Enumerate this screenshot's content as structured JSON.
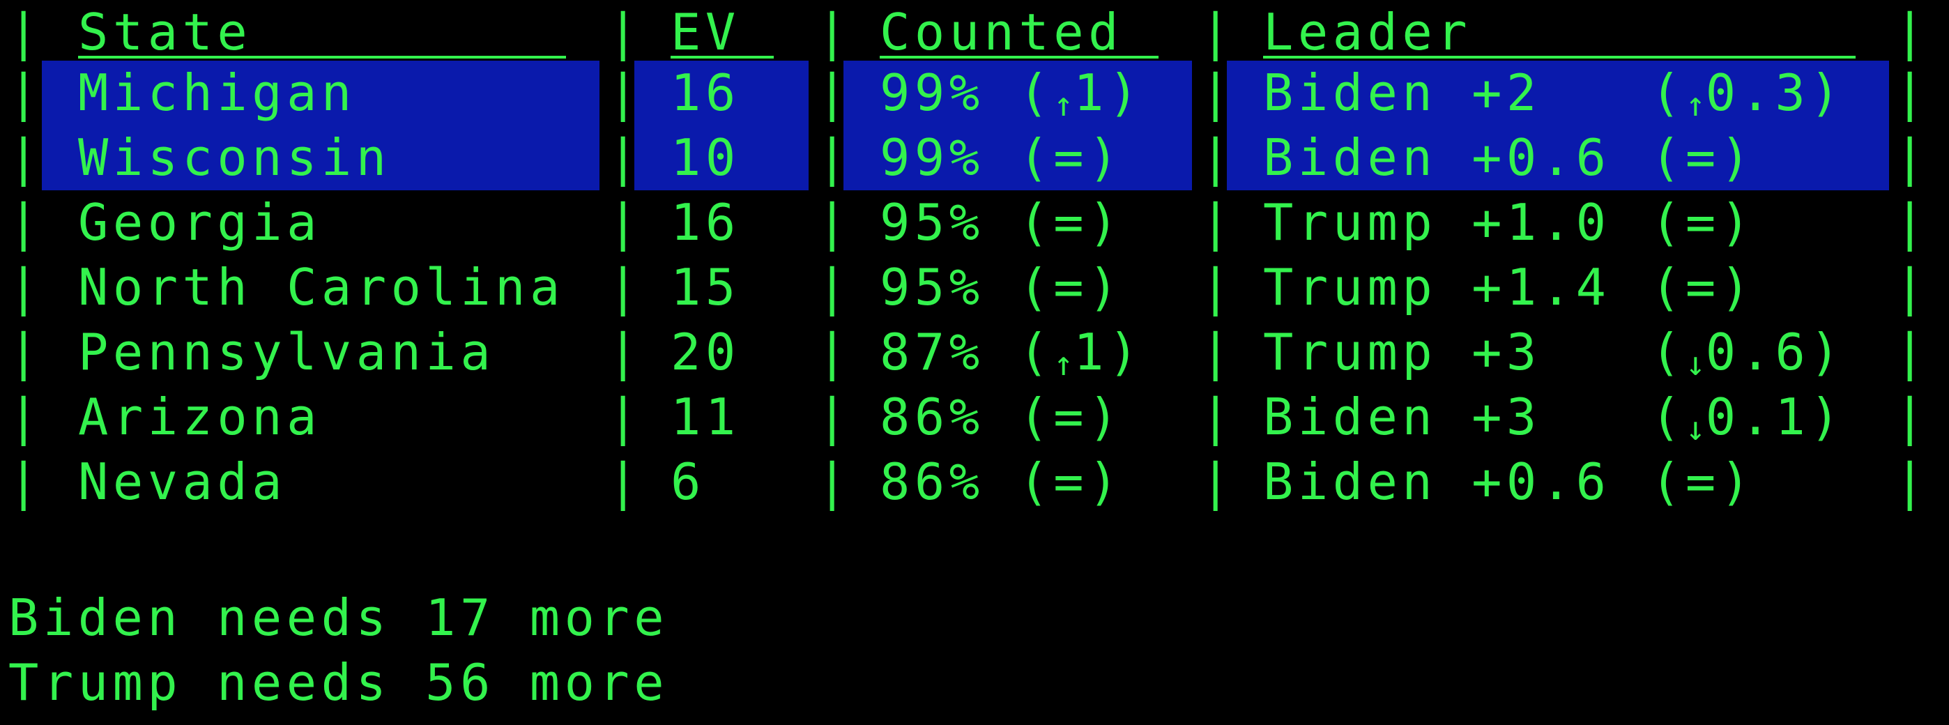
{
  "table": {
    "columns": [
      "State",
      "EV",
      "Counted",
      "Leader"
    ],
    "rows": [
      {
        "state": "Michigan",
        "ev": "16",
        "counted_pct": "99%",
        "counted_delta": "(",
        "counted_arrow": "↑",
        "counted_change": "1)",
        "leader": "Biden +2",
        "leader_delta_open": "(",
        "leader_arrow": "↑",
        "leader_change": "0.3)",
        "highlighted": true
      },
      {
        "state": "Wisconsin",
        "ev": "10",
        "counted_pct": "99%",
        "counted_delta": "(=)",
        "counted_arrow": "",
        "counted_change": "",
        "leader": "Biden +0.6",
        "leader_delta_open": "(=)",
        "leader_arrow": "",
        "leader_change": "",
        "highlighted": true
      },
      {
        "state": "Georgia",
        "ev": "16",
        "counted_pct": "95%",
        "counted_delta": "(=)",
        "counted_arrow": "",
        "counted_change": "",
        "leader": "Trump +1.0",
        "leader_delta_open": "(=)",
        "leader_arrow": "",
        "leader_change": "",
        "highlighted": false
      },
      {
        "state": "North Carolina",
        "ev": "15",
        "counted_pct": "95%",
        "counted_delta": "(=)",
        "counted_arrow": "",
        "counted_change": "",
        "leader": "Trump +1.4",
        "leader_delta_open": "(=)",
        "leader_arrow": "",
        "leader_change": "",
        "highlighted": false
      },
      {
        "state": "Pennsylvania",
        "ev": "20",
        "counted_pct": "87%",
        "counted_delta": "(",
        "counted_arrow": "↑",
        "counted_change": "1)",
        "leader": "Trump +3",
        "leader_delta_open": "(",
        "leader_arrow": "↓",
        "leader_change": "0.6)",
        "highlighted": false
      },
      {
        "state": "Arizona",
        "ev": "11",
        "counted_pct": "86%",
        "counted_delta": "(=)",
        "counted_arrow": "",
        "counted_change": "",
        "leader": "Biden +3",
        "leader_delta_open": "(",
        "leader_arrow": "↓",
        "leader_change": "0.1)",
        "highlighted": false
      },
      {
        "state": "Nevada",
        "ev": "6",
        "counted_pct": "86%",
        "counted_delta": "(=)",
        "counted_arrow": "",
        "counted_change": "",
        "leader": "Biden +0.6",
        "leader_delta_open": "(=)",
        "leader_arrow": "",
        "leader_change": "",
        "highlighted": false
      }
    ]
  },
  "footer": {
    "biden_needs": "Biden needs 17 more",
    "trump_needs": "Trump needs 56 more"
  },
  "colors": {
    "background": "#000000",
    "text": "#33f24d",
    "highlight": "#0a1aac"
  }
}
